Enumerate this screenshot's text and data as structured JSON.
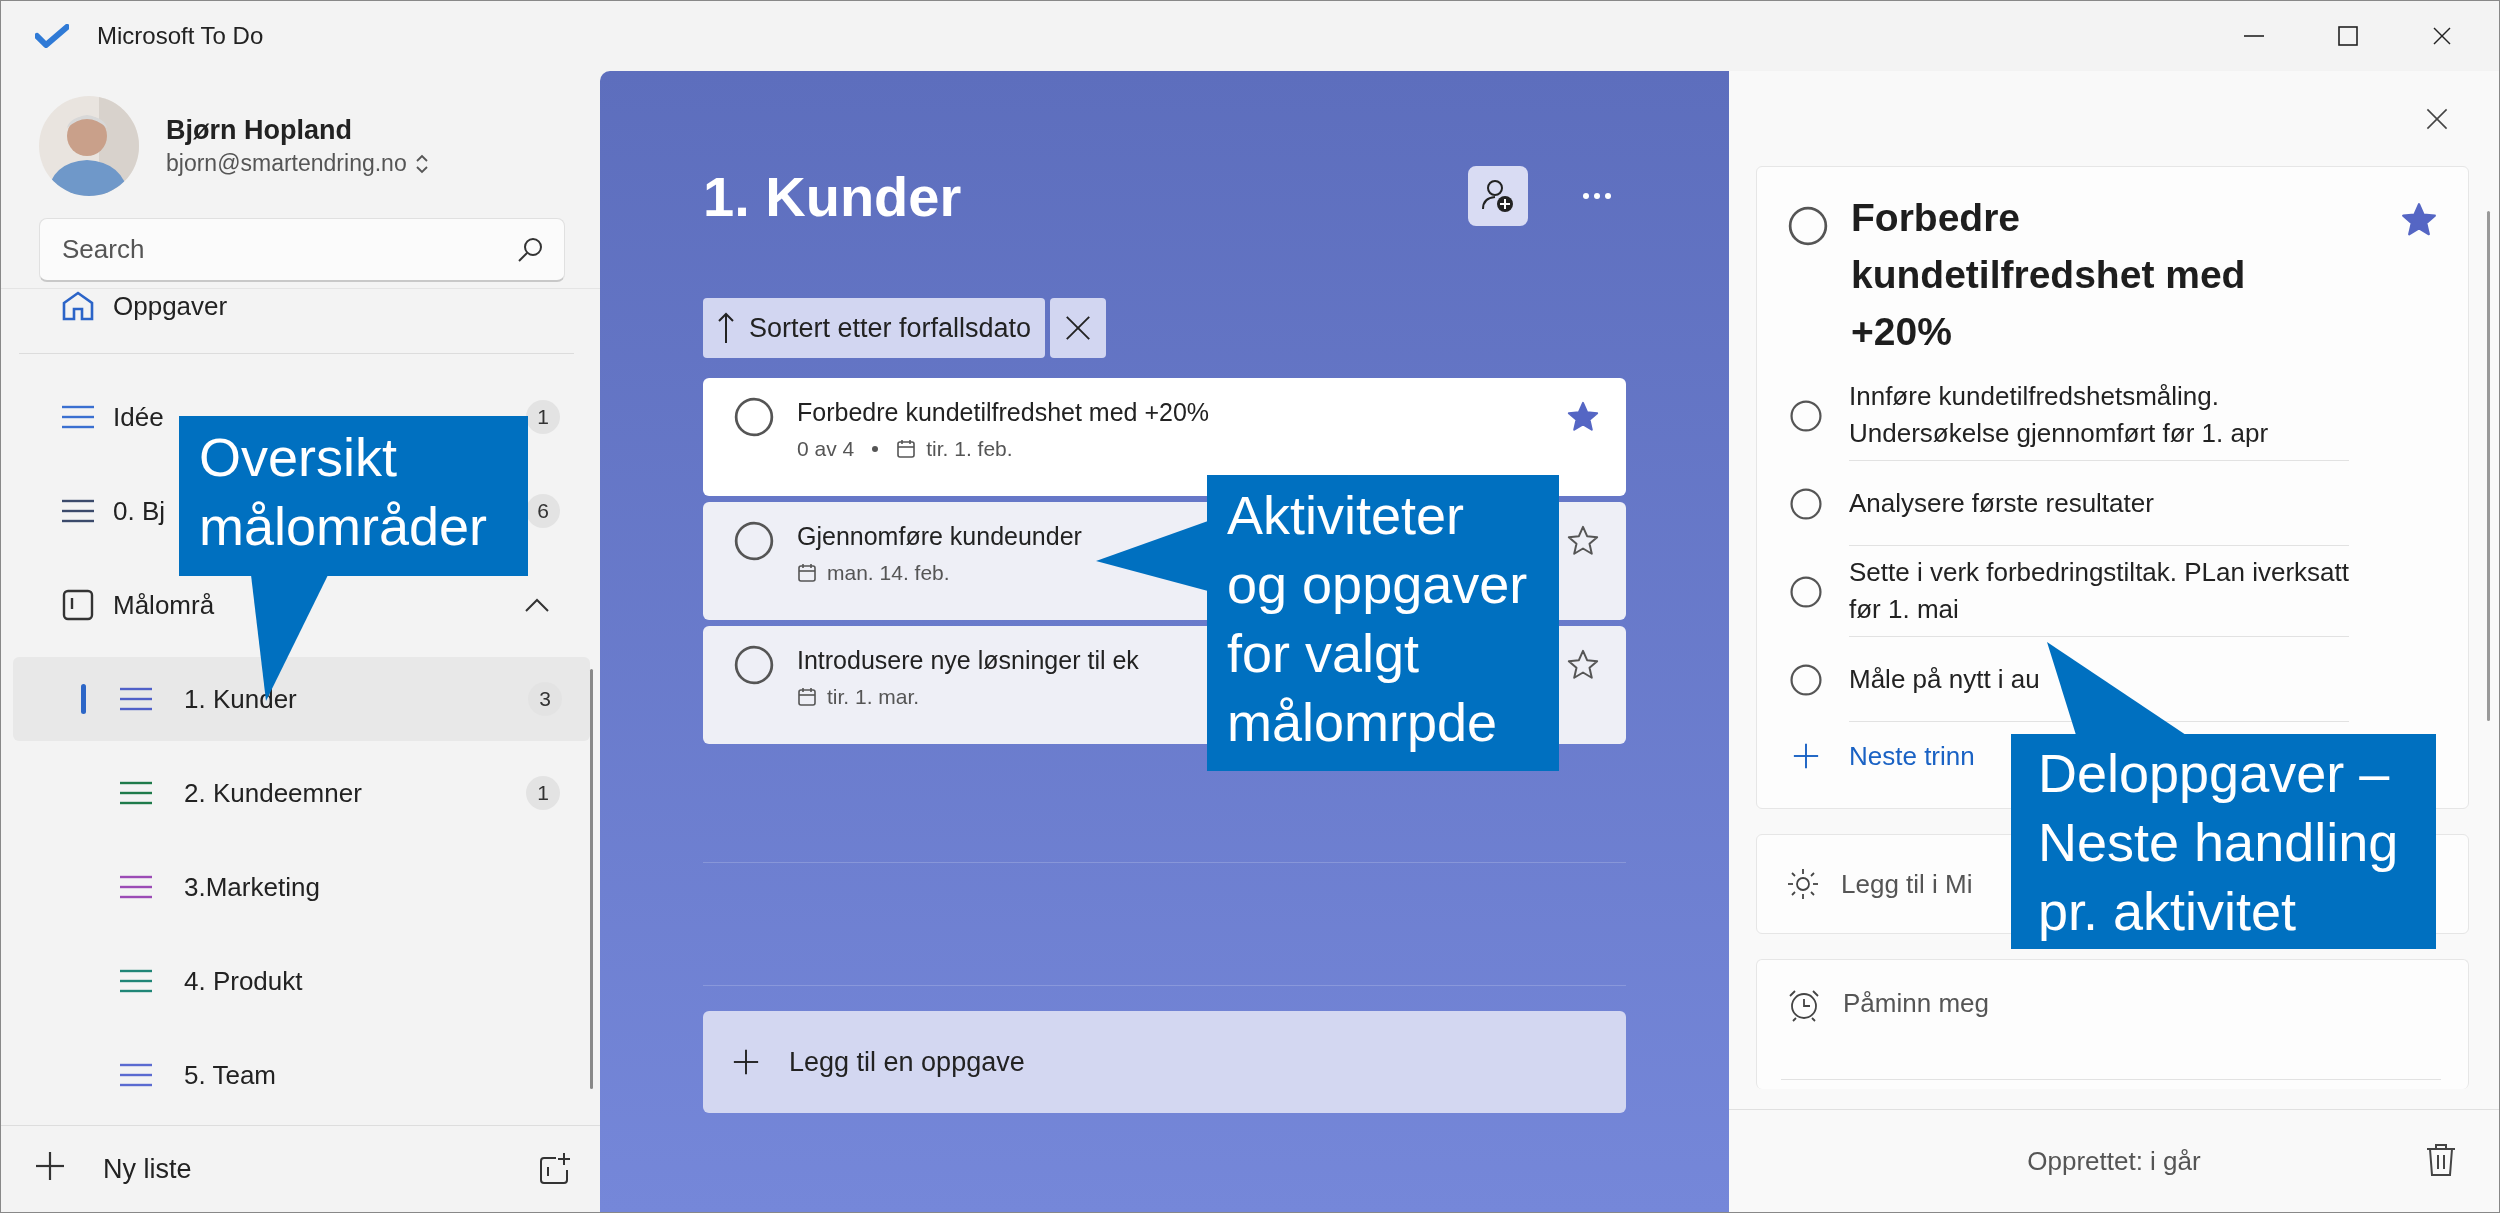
{
  "window": {
    "title": "Microsoft To Do"
  },
  "profile": {
    "name": "Bjørn Hopland",
    "email": "bjorn@smartendring.no"
  },
  "search": {
    "placeholder": "Search"
  },
  "sidebar": {
    "items": [
      {
        "kind": "home",
        "label": "Oppgaver",
        "selected": false
      },
      {
        "kind": "list",
        "label": "Idée",
        "count": "1",
        "color": "#3a6fd0",
        "selected": false
      },
      {
        "kind": "list",
        "label": "0. Bj",
        "count": "6",
        "color": "#3b4a6b",
        "selected": false
      },
      {
        "kind": "group",
        "label": "Målområ",
        "expanded": true,
        "selected": false,
        "children": [
          {
            "label": "1. Kunder",
            "count": "3",
            "color": "#5060c8",
            "selected": true
          },
          {
            "label": "2. Kundeemner",
            "count": "1",
            "color": "#1e7a4a",
            "selected": false
          },
          {
            "label": "3.Marketing",
            "color": "#9b4bb5",
            "selected": false
          },
          {
            "label": "4. Produkt",
            "color": "#1f8576",
            "selected": false
          },
          {
            "label": "5. Team",
            "color": "#5a6ad0",
            "selected": false
          }
        ]
      }
    ]
  },
  "new_list": {
    "label": "Ny liste"
  },
  "list": {
    "title": "1. Kunder",
    "sort": "Sortert etter forfallsdato",
    "tasks": [
      {
        "title": "Forbedre kundetilfredshet med +20%",
        "steps": "0 av 4",
        "due": "tir. 1. feb.",
        "important": true,
        "selected": true
      },
      {
        "title": "Gjennomføre kundeunder",
        "due": "man. 14. feb.",
        "important": false,
        "selected": false
      },
      {
        "title": "Introdusere nye løsninger til ek",
        "due": "tir. 1. mar.",
        "important": false,
        "selected": false
      }
    ],
    "add_task": {
      "placeholder": "Legg til en oppgave"
    }
  },
  "detail": {
    "title": "Forbedre kundetilfredshet med +20%",
    "important": true,
    "steps": [
      {
        "text": "Innføre kundetilfredshetsmåling. Undersøkelse gjennomført før 1. apr"
      },
      {
        "text": "Analysere første resultater"
      },
      {
        "text": "Sette i verk forbedringstiltak. PLan iverksatt før 1. mai"
      },
      {
        "text": "Måle på nytt i au"
      }
    ],
    "next_step": "Neste trinn",
    "my_day": "Legg til i Mi",
    "reminder": "Påminn meg",
    "created": "Opprettet: i går"
  },
  "callouts": [
    {
      "text": "Oversikt\nmålområder"
    },
    {
      "text": "Aktiviteter\nog oppgaver\nfor valgt\nmålomrpde"
    },
    {
      "text": "Deloppgaver –\nNeste handling\npr. aktivitet"
    }
  ]
}
